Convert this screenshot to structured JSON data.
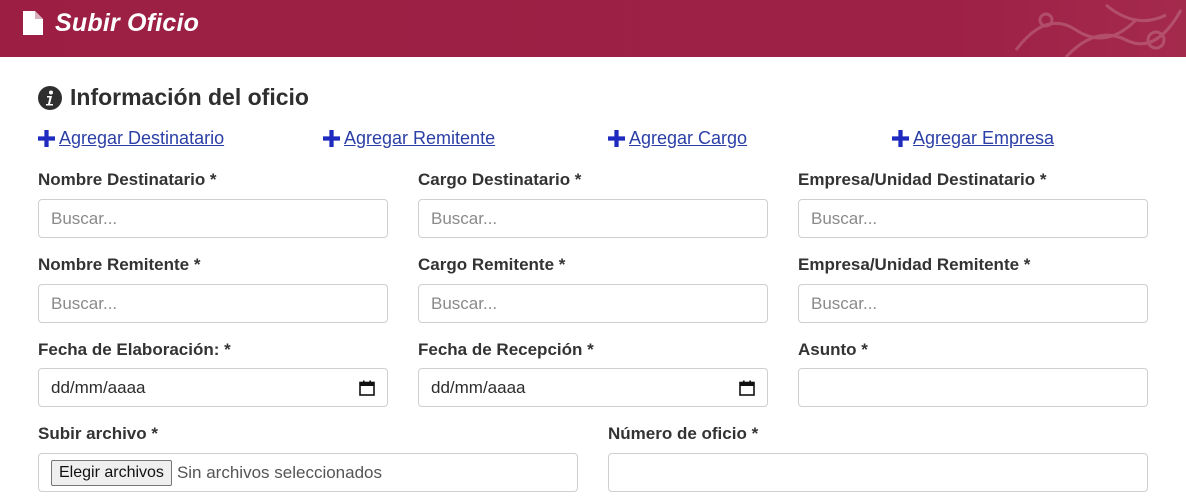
{
  "header": {
    "title": "Subir Oficio",
    "icon": "file-icon"
  },
  "section": {
    "title": "Información del oficio",
    "icon": "info-icon"
  },
  "links": [
    {
      "label": " Agregar Destinatario"
    },
    {
      "label": " Agregar Remitente"
    },
    {
      "label": " Agregar Cargo"
    },
    {
      "label": " Agregar Empresa"
    }
  ],
  "fields": {
    "nombre_destinatario": {
      "label": "Nombre Destinatario *",
      "placeholder": "Buscar..."
    },
    "cargo_destinatario": {
      "label": "Cargo Destinatario *",
      "placeholder": "Buscar..."
    },
    "empresa_destinatario": {
      "label": "Empresa/Unidad Destinatario *",
      "placeholder": "Buscar..."
    },
    "nombre_remitente": {
      "label": "Nombre Remitente *",
      "placeholder": "Buscar..."
    },
    "cargo_remitente": {
      "label": "Cargo Remitente *",
      "placeholder": "Buscar..."
    },
    "empresa_remitente": {
      "label": "Empresa/Unidad Remitente *",
      "placeholder": "Buscar..."
    },
    "fecha_elaboracion": {
      "label": "Fecha de Elaboración: *",
      "value": "dd/mm/aaaa"
    },
    "fecha_recepcion": {
      "label": "Fecha de Recepción *",
      "value": "dd/mm/aaaa"
    },
    "asunto": {
      "label": "Asunto *",
      "value": ""
    },
    "archivo": {
      "label": "Subir archivo *",
      "button": "Elegir archivos",
      "status": "Sin archivos seleccionados"
    },
    "numero_oficio": {
      "label": "Número de oficio *",
      "value": ""
    }
  },
  "colors": {
    "header": "#9c1f43",
    "link": "#2b3fa6",
    "plus": "#1f2bbf"
  }
}
